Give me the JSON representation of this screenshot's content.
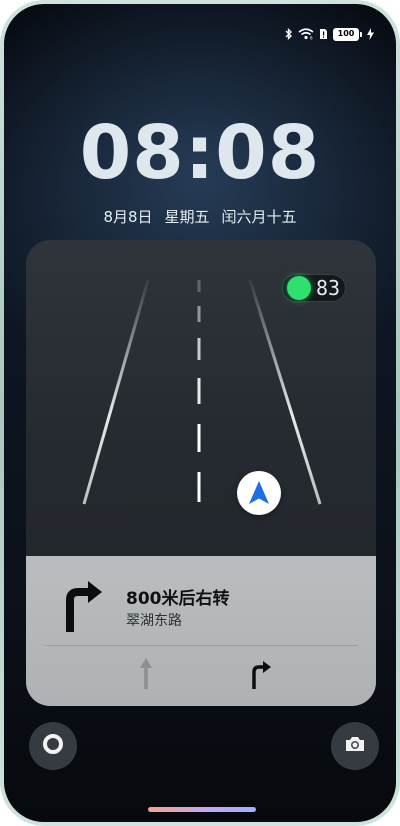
{
  "status_bar": {
    "icons": [
      "bluetooth-icon",
      "wifi-icon",
      "sim-icon",
      "charging-icon"
    ],
    "battery_level": "100"
  },
  "lock_screen": {
    "time": "08:08",
    "date": "8月8日",
    "weekday": "星期五",
    "lunar_date": "闰六月十五"
  },
  "navigation": {
    "traffic_light": {
      "color": "#2fe06f",
      "countdown": "83"
    },
    "instruction": {
      "distance": "800米后右转",
      "road": "翠湖东路"
    },
    "lanes": [
      {
        "direction": "straight",
        "active": false
      },
      {
        "direction": "right",
        "active": true
      }
    ],
    "accent_color": "#1e6fe0"
  },
  "buttons": {
    "left_icon": "circle-icon",
    "right_icon": "camera-icon"
  }
}
